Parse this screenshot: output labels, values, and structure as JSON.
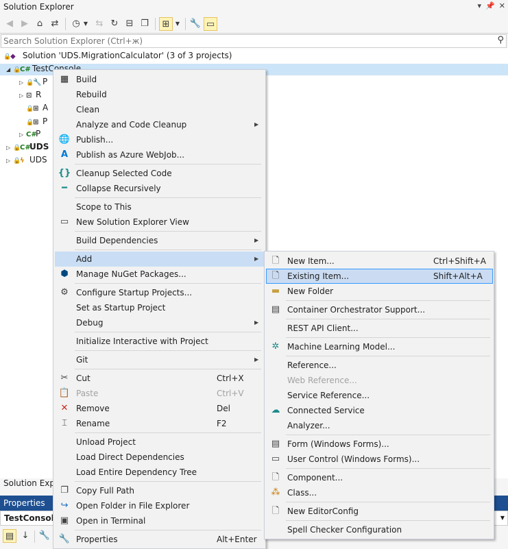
{
  "solution_explorer": {
    "title": "Solution Explorer",
    "title_buttons": [
      "▾",
      "📌",
      "✕"
    ],
    "search_placeholder": "Search Solution Explorer (Ctrl+ж)",
    "tree": {
      "solution": "Solution 'UDS.MigrationCalculator' (3 of 3 projects)",
      "selected_project": "TestConsole",
      "child_initials": [
        "P",
        "R",
        "A",
        "P",
        "P"
      ],
      "projects": [
        "UDS",
        "UDS"
      ]
    },
    "bottom_tab": "Solution Explo"
  },
  "properties": {
    "title": "Properties",
    "object": "TestConsole"
  },
  "context_menu": {
    "items": [
      {
        "label": "Build",
        "icon": "build-icon"
      },
      {
        "label": "Rebuild"
      },
      {
        "label": "Clean"
      },
      {
        "label": "Analyze and Code Cleanup",
        "submenu": true
      },
      {
        "label": "Publish...",
        "icon": "globe-icon"
      },
      {
        "label": "Publish as Azure WebJob...",
        "icon": "azure-icon"
      },
      {
        "label": "Cleanup Selected Code",
        "icon": "braces-icon"
      },
      {
        "label": "Collapse Recursively",
        "icon": "collapse-icon"
      },
      {
        "label": "Scope to This"
      },
      {
        "label": "New Solution Explorer View",
        "icon": "new-view-icon"
      },
      {
        "label": "Build Dependencies",
        "submenu": true
      },
      {
        "label": "Add",
        "submenu": true
      },
      {
        "label": "Manage NuGet Packages...",
        "icon": "nuget-icon"
      },
      {
        "label": "Configure Startup Projects...",
        "icon": "gear-icon"
      },
      {
        "label": "Set as Startup Project"
      },
      {
        "label": "Debug",
        "submenu": true
      },
      {
        "label": "Initialize Interactive with Project"
      },
      {
        "label": "Git",
        "submenu": true
      },
      {
        "label": "Cut",
        "shortcut": "Ctrl+X",
        "icon": "scissors-icon"
      },
      {
        "label": "Paste",
        "shortcut": "Ctrl+V",
        "icon": "paste-icon",
        "disabled": true
      },
      {
        "label": "Remove",
        "shortcut": "Del",
        "icon": "remove-icon"
      },
      {
        "label": "Rename",
        "shortcut": "F2",
        "icon": "rename-icon"
      },
      {
        "label": "Unload Project"
      },
      {
        "label": "Load Direct Dependencies"
      },
      {
        "label": "Load Entire Dependency Tree"
      },
      {
        "label": "Copy Full Path",
        "icon": "copy-icon"
      },
      {
        "label": "Open Folder in File Explorer",
        "icon": "open-folder-icon"
      },
      {
        "label": "Open in Terminal",
        "icon": "terminal-icon"
      },
      {
        "label": "Properties",
        "shortcut": "Alt+Enter",
        "icon": "wrench-icon"
      }
    ]
  },
  "add_submenu": {
    "items": [
      {
        "label": "New Item...",
        "shortcut": "Ctrl+Shift+A",
        "icon": "new-item-icon"
      },
      {
        "label": "Existing Item...",
        "shortcut": "Shift+Alt+A",
        "icon": "existing-item-icon"
      },
      {
        "label": "New Folder",
        "icon": "new-folder-icon"
      },
      {
        "label": "Container Orchestrator Support...",
        "icon": "container-icon"
      },
      {
        "label": "REST API Client..."
      },
      {
        "label": "Machine Learning Model...",
        "icon": "ml-icon"
      },
      {
        "label": "Reference..."
      },
      {
        "label": "Web Reference...",
        "disabled": true
      },
      {
        "label": "Service Reference..."
      },
      {
        "label": "Connected Service",
        "icon": "connected-service-icon"
      },
      {
        "label": "Analyzer..."
      },
      {
        "label": "Form (Windows Forms)...",
        "icon": "form-icon"
      },
      {
        "label": "User Control (Windows Forms)...",
        "icon": "user-control-icon"
      },
      {
        "label": "Component...",
        "icon": "component-icon"
      },
      {
        "label": "Class...",
        "icon": "class-icon"
      },
      {
        "label": "New EditorConfig",
        "icon": "editorconfig-icon"
      },
      {
        "label": "Spell Checker Configuration"
      }
    ]
  }
}
